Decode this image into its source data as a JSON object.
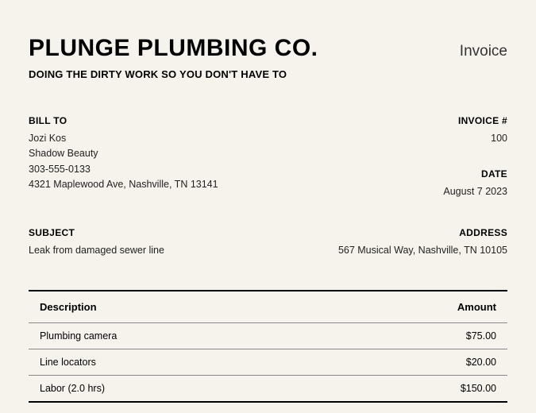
{
  "header": {
    "company_name": "PLUNGE PLUMBING CO.",
    "doc_type": "Invoice",
    "tagline": "DOING THE DIRTY WORK SO YOU DON'T HAVE TO"
  },
  "bill_to": {
    "label": "BILL TO",
    "name": "Jozi Kos",
    "company": "Shadow Beauty",
    "phone": "303-555-0133",
    "address": "4321 Maplewood Ave, Nashville, TN 13141"
  },
  "invoice_meta": {
    "number_label": "INVOICE #",
    "number": "100",
    "date_label": "DATE",
    "date": "August 7 2023"
  },
  "subject": {
    "label": "SUBJECT",
    "text": "Leak from damaged sewer line"
  },
  "service_address": {
    "label": "ADDRESS",
    "text": "567 Musical Way, Nashville, TN 10105"
  },
  "table": {
    "headers": {
      "description": "Description",
      "amount": "Amount"
    },
    "rows": [
      {
        "description": "Plumbing camera",
        "amount": "$75.00"
      },
      {
        "description": "Line locators",
        "amount": "$20.00"
      },
      {
        "description": "Labor (2.0 hrs)",
        "amount": "$150.00"
      }
    ]
  }
}
